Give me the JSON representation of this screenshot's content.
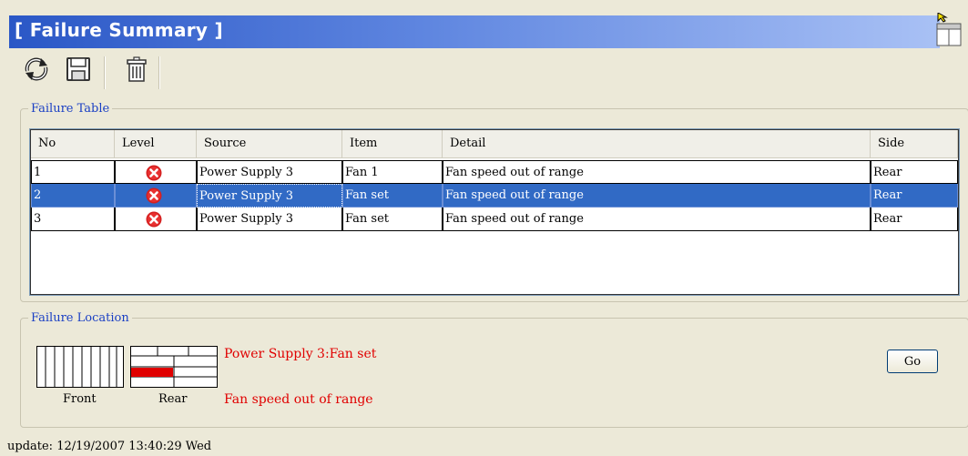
{
  "window": {
    "title": "[ Failure Summary ]"
  },
  "toolbar": {
    "icons": [
      "refresh-icon",
      "save-icon",
      "delete-icon"
    ]
  },
  "failure_table": {
    "legend": "Failure Table",
    "columns": [
      "No",
      "Level",
      "Source",
      "Item",
      "Detail",
      "Side"
    ],
    "rows": [
      {
        "no": "1",
        "level": "error-icon",
        "source": "Power Supply 3",
        "item": "Fan 1",
        "detail": "Fan speed out of range",
        "side": "Rear",
        "selected": false
      },
      {
        "no": "2",
        "level": "error-icon",
        "source": "Power Supply 3",
        "item": "Fan set",
        "detail": "Fan speed out of range",
        "side": "Rear",
        "selected": true
      },
      {
        "no": "3",
        "level": "error-icon",
        "source": "Power Supply 3",
        "item": "Fan set",
        "detail": "Fan speed out of range",
        "side": "Rear",
        "selected": false
      }
    ]
  },
  "failure_location": {
    "legend": "Failure Location",
    "front_label": "Front",
    "rear_label": "Rear",
    "message_source": "Power Supply 3:Fan set",
    "message_detail": "Fan speed out of range",
    "go_label": "Go",
    "highlight_color": "#e00000"
  },
  "status": {
    "update": "update: 12/19/2007 13:40:29 Wed"
  }
}
